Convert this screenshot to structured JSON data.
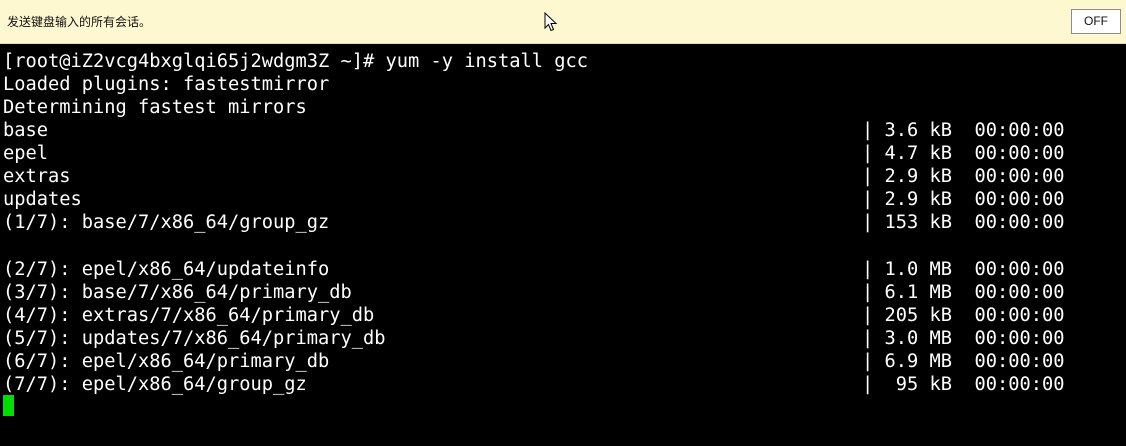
{
  "banner": {
    "message": "发送键盘输入的所有会话。",
    "off_label": "OFF"
  },
  "terminal": {
    "prompt_line": "[root@iZ2vcg4bxglqi65j2wdgm3Z ~]# yum -y install gcc",
    "lines": [
      {
        "left": "Loaded plugins: fastestmirror",
        "right": ""
      },
      {
        "left": "Determining fastest mirrors",
        "right": ""
      },
      {
        "left": "base",
        "right": "| 3.6 kB  00:00:00"
      },
      {
        "left": "epel",
        "right": "| 4.7 kB  00:00:00"
      },
      {
        "left": "extras",
        "right": "| 2.9 kB  00:00:00"
      },
      {
        "left": "updates",
        "right": "| 2.9 kB  00:00:00"
      },
      {
        "left": "(1/7): base/7/x86_64/group_gz",
        "right": "| 153 kB  00:00:00"
      },
      {
        "left": "",
        "right": ""
      },
      {
        "left": "(2/7): epel/x86_64/updateinfo",
        "right": "| 1.0 MB  00:00:00"
      },
      {
        "left": "(3/7): base/7/x86_64/primary_db",
        "right": "| 6.1 MB  00:00:00"
      },
      {
        "left": "(4/7): extras/7/x86_64/primary_db",
        "right": "| 205 kB  00:00:00"
      },
      {
        "left": "(5/7): updates/7/x86_64/primary_db",
        "right": "| 3.0 MB  00:00:00"
      },
      {
        "left": "(6/7): epel/x86_64/primary_db",
        "right": "| 6.9 MB  00:00:00"
      },
      {
        "left": "(7/7): epel/x86_64/group_gz",
        "right": "|  95 kB  00:00:00"
      }
    ]
  },
  "colors": {
    "banner_bg": "#fdf8cf",
    "terminal_bg": "#000000",
    "terminal_fg": "#ffffff",
    "cursor": "#00e000"
  },
  "icons": {
    "mouse_pointer": "mouse-pointer-icon"
  }
}
